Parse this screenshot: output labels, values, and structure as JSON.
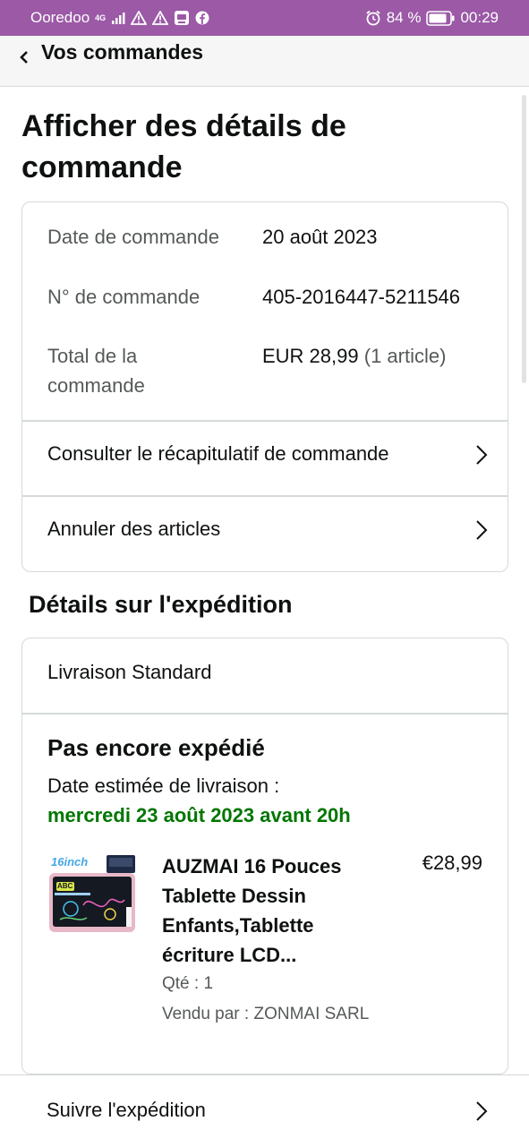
{
  "status_bar": {
    "carrier": "Ooredoo",
    "network": "4G",
    "battery": "84 %",
    "time": "00:29"
  },
  "nav": {
    "back_title": "Vos commandes"
  },
  "page": {
    "title": "Afficher des détails de commande"
  },
  "order": {
    "date_label": "Date de commande",
    "date_value": "20 août 2023",
    "number_label": "N° de commande",
    "number_value": "405-2016447-5211546",
    "total_label": "Total de la commande",
    "total_value": "EUR 28,99",
    "total_count": "(1 article)"
  },
  "actions": {
    "summary": "Consulter le récapitulatif de commande",
    "cancel": "Annuler des articles"
  },
  "shipment": {
    "section_title": "Détails sur l'expédition",
    "method": "Livraison Standard",
    "status": "Pas encore expédié",
    "estimate_label": "Date estimée de livraison :",
    "estimate_date": "mercredi 23 août 2023 avant 20h",
    "estimate_color": "#007600",
    "item": {
      "title": "AUZMAI 16 Pouces Tablette Dessin Enfants,Tablette écriture LCD...",
      "price": "€28,99",
      "qty": "Qté : 1",
      "seller": "Vendu par : ZONMAI SARL",
      "image_text_size": "16inch",
      "image_text_abc": "ABC"
    },
    "track": "Suivre l'expédition"
  },
  "colors": {
    "status_bar": "#9b59a6",
    "border": "#d5d9d9",
    "muted": "#565959"
  }
}
